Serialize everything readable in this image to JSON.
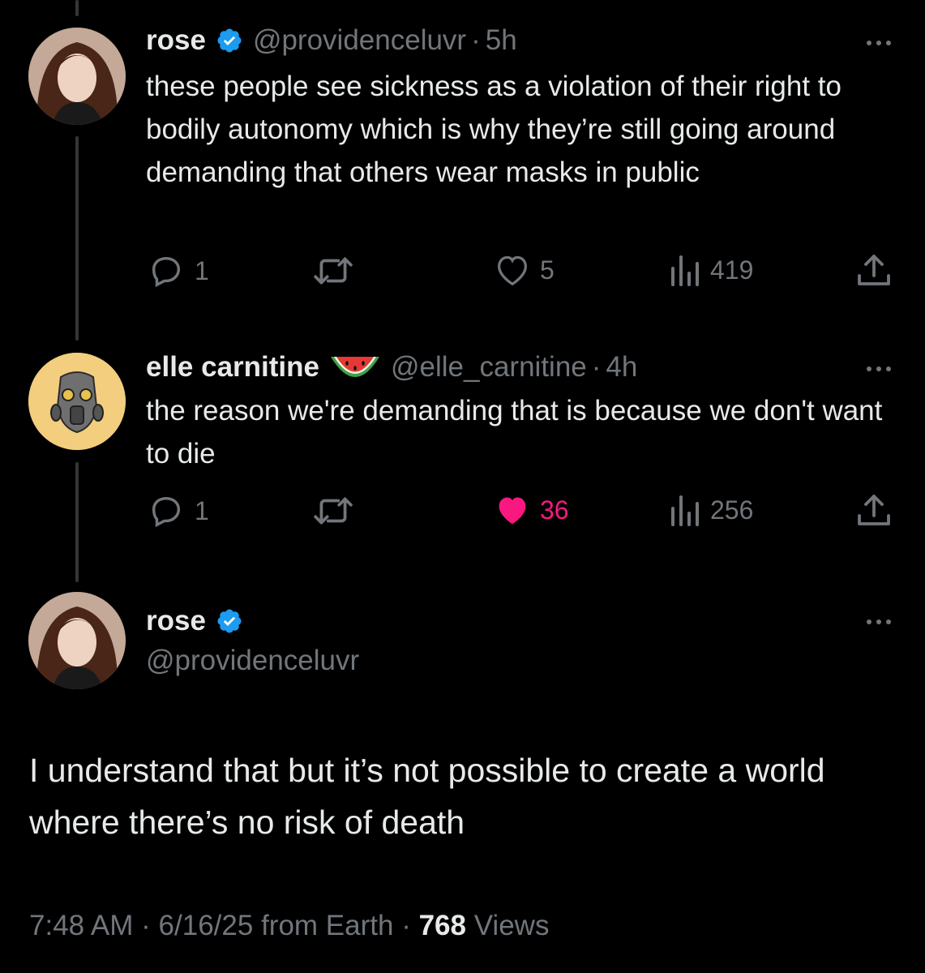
{
  "tweets": [
    {
      "name": "rose",
      "handle": "@providenceluvr",
      "sep": "·",
      "time": "5h",
      "text": "these people see sickness as a violation of their right to bodily autonomy which is why they’re still going around demanding that others wear masks in public",
      "replies": "1",
      "likes": "5",
      "views": "419"
    },
    {
      "name": "elle carnitine",
      "handle": "@elle_carnitine",
      "sep": "·",
      "time": "4h",
      "text": "the reason we're demanding that is because we don't want to die",
      "replies": "1",
      "likes": "36",
      "views": "256"
    }
  ],
  "main": {
    "name": "rose",
    "handle": "@providenceluvr",
    "text": "I understand that but it’s not possible to create a world where there’s no risk of death",
    "time": "7:48 AM",
    "date": "6/16/25",
    "from": "from Earth",
    "views_count": "768",
    "views_label": "Views"
  },
  "icons": {
    "verified": "verified-badge-icon",
    "reply": "reply-icon",
    "retweet": "retweet-icon",
    "like": "heart-icon",
    "views": "views-icon",
    "share": "share-icon",
    "more": "more-icon",
    "emoji": "watermelon-icon"
  },
  "colors": {
    "background": "#000000",
    "text": "#e7e9ea",
    "muted": "#71767b",
    "verified": "#1d9bf0",
    "liked": "#f91880"
  }
}
